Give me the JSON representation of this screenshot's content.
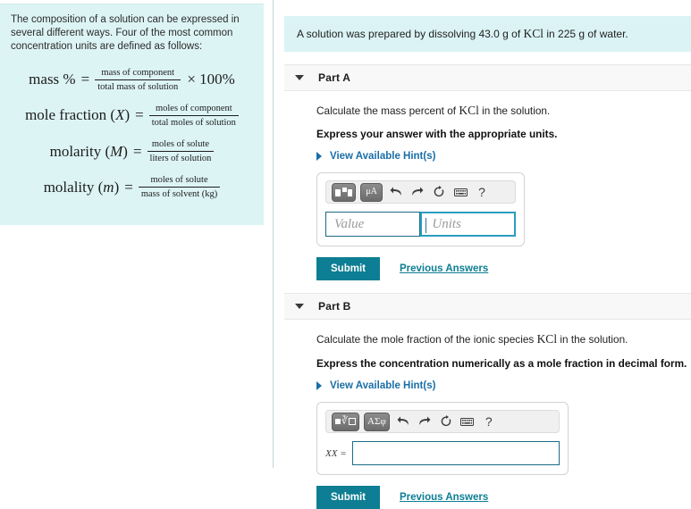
{
  "left_panel": {
    "intro_text": "The composition of a solution can be expressed in several different ways. Four of the most common concentration units are defined as follows:",
    "formulas": [
      {
        "lhs": "mass %",
        "lhs_var": "",
        "numerator": "mass of component",
        "denominator": "total mass of solution",
        "tail": "× 100%"
      },
      {
        "lhs": "mole fraction (",
        "lhs_var": "X",
        "lhs_close": ")",
        "numerator": "moles of component",
        "denominator": "total moles of solution",
        "tail": ""
      },
      {
        "lhs": "molarity (",
        "lhs_var": "M",
        "lhs_close": ")",
        "numerator": "moles of solute",
        "denominator": "liters of solution",
        "tail": ""
      },
      {
        "lhs": "molality (",
        "lhs_var": "m",
        "lhs_close": ")",
        "numerator": "moles of solute",
        "denominator": "mass of solvent (kg)",
        "tail": ""
      }
    ],
    "equals": "="
  },
  "problem": {
    "text_before": "A solution was prepared by dissolving 43.0 g of ",
    "chem": "KCl",
    "text_after": " in 225 g of water."
  },
  "parts": [
    {
      "id": "part-a",
      "title": "Part A",
      "question_before": "Calculate the mass percent of ",
      "question_chem": "KCl",
      "question_after": " in the solution.",
      "instruction": "Express your answer with the appropriate units.",
      "hint_label": "View Available Hint(s)",
      "toolbar": {
        "template_icon": "math-template-icon",
        "unit_icon": "μA",
        "undo_icon": "undo-icon",
        "redo_icon": "redo-icon",
        "reset_icon": "reset-icon",
        "keyboard_icon": "keyboard-icon",
        "help_icon": "?"
      },
      "value_placeholder": "Value",
      "units_placeholder": "Units",
      "value_text": "",
      "units_text": "",
      "submit_label": "Submit",
      "previous_label": "Previous Answers"
    },
    {
      "id": "part-b",
      "title": "Part B",
      "question_before": "Calculate the mole fraction of the ionic species ",
      "question_chem": "KCl",
      "question_after": " in the solution.",
      "instruction": "Express the concentration numerically as a mole fraction in decimal form.",
      "hint_label": "View Available Hint(s)",
      "toolbar": {
        "template_icon": "radical-template-icon",
        "greek_icon": "ΑΣφ",
        "undo_icon": "undo-icon",
        "redo_icon": "redo-icon",
        "reset_icon": "reset-icon",
        "keyboard_icon": "keyboard-icon",
        "help_icon": "?"
      },
      "input_label": "XX =",
      "input_value": "",
      "submit_label": "Submit",
      "previous_label": "Previous Answers"
    }
  ],
  "colors": {
    "teal_accent": "#0d7e93",
    "hint_blue": "#1a6ea8",
    "banner_bg": "#dbf3f5",
    "panel_bg": "#ddf4f4",
    "field_border": "#1b6b85",
    "focus_border": "#2a9ec0"
  }
}
